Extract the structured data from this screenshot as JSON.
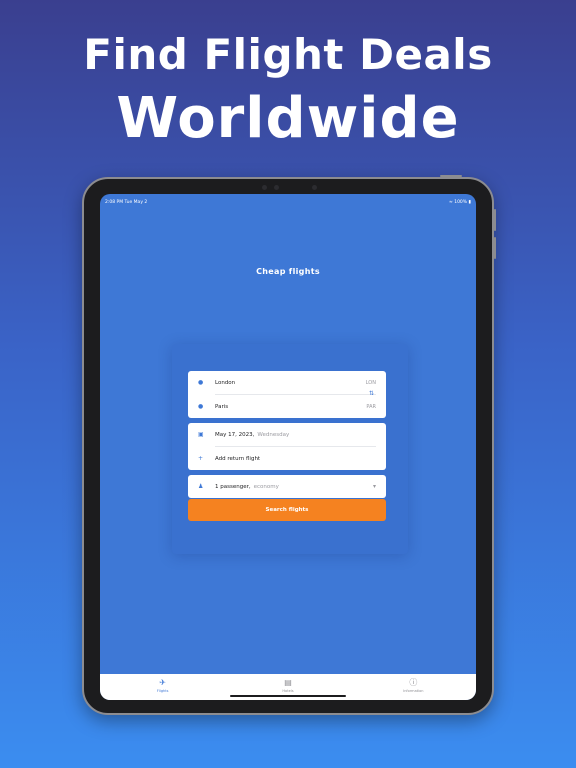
{
  "promo": {
    "line1": "Find Flight Deals",
    "line2": "Worldwide"
  },
  "status_bar": {
    "time_date": "2:08 PM  Tue May 2",
    "battery": "100%"
  },
  "screen_title": "Cheap flights",
  "route": {
    "origin": {
      "city": "London",
      "code": "LON",
      "icon": "location-pin-icon"
    },
    "destination": {
      "city": "Paris",
      "code": "PAR",
      "icon": "location-pin-icon"
    },
    "swap_icon": "swap-icon"
  },
  "dates": {
    "departure_date": "May 17, 2023,",
    "departure_weekday": "Wednesday",
    "add_return": "Add return flight"
  },
  "passengers": {
    "count": "1 passenger,",
    "cabin": "economy"
  },
  "search_button": "Search flights",
  "tabs": [
    {
      "label": "Flights",
      "icon": "airplane-icon",
      "active": true
    },
    {
      "label": "Hotels",
      "icon": "bed-icon",
      "active": false
    },
    {
      "label": "Information",
      "icon": "info-icon",
      "active": false
    }
  ],
  "colors": {
    "accent": "#3e78d6",
    "cta": "#f58220"
  }
}
